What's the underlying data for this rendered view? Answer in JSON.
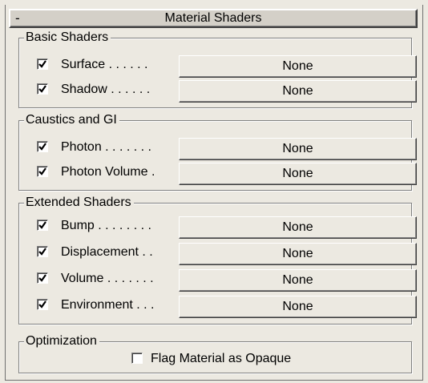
{
  "rollout": {
    "collapse_glyph": "-",
    "title": "Material Shaders"
  },
  "groups": {
    "basic": {
      "title": "Basic Shaders",
      "rows": [
        {
          "label": "Surface . . . . . .",
          "checked": true,
          "shader": "None"
        },
        {
          "label": "Shadow . . . . . .",
          "checked": true,
          "shader": "None"
        }
      ]
    },
    "caustics": {
      "title": "Caustics and GI",
      "rows": [
        {
          "label": "Photon . . . . . . .",
          "checked": true,
          "shader": "None"
        },
        {
          "label": "Photon Volume .",
          "checked": true,
          "shader": "None"
        }
      ]
    },
    "extended": {
      "title": "Extended Shaders",
      "rows": [
        {
          "label": "Bump . . . . . . . .",
          "checked": true,
          "shader": "None"
        },
        {
          "label": "Displacement . .",
          "checked": true,
          "shader": "None"
        },
        {
          "label": "Volume . . . . . . .",
          "checked": true,
          "shader": "None"
        },
        {
          "label": "Environment . . .",
          "checked": true,
          "shader": "None"
        }
      ]
    },
    "optimization": {
      "title": "Optimization",
      "flag_label": "Flag Material as Opaque",
      "flag_checked": false
    }
  },
  "icons": {
    "check": "checkmark-icon"
  }
}
